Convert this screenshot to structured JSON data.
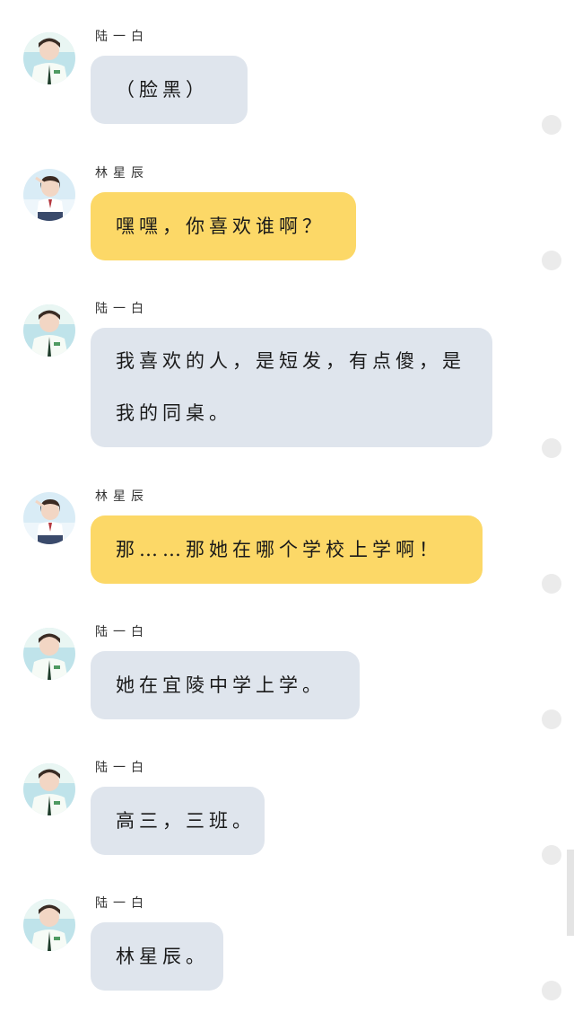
{
  "messages": [
    {
      "sender": "陆一白",
      "text": "（脸黑）",
      "avatar": "boy-avatar-icon"
    },
    {
      "sender": "林星辰",
      "text": "嘿嘿，你喜欢谁啊？",
      "avatar": "girl-avatar-icon"
    },
    {
      "sender": "陆一白",
      "text": "我喜欢的人，是短发，有点傻，是我的同桌。",
      "avatar": "boy-avatar-icon"
    },
    {
      "sender": "林星辰",
      "text": "那……那她在哪个学校上学啊！",
      "avatar": "girl-avatar-icon"
    },
    {
      "sender": "陆一白",
      "text": "她在宜陵中学上学。",
      "avatar": "boy-avatar-icon"
    },
    {
      "sender": "陆一白",
      "text": "高三，三班。",
      "avatar": "boy-avatar-icon"
    },
    {
      "sender": "陆一白",
      "text": "林星辰。",
      "avatar": "boy-avatar-icon"
    }
  ],
  "colors": {
    "bubble_gray": "#dfe5ed",
    "bubble_yellow": "#fcd867",
    "status_dot": "#ebebeb"
  }
}
